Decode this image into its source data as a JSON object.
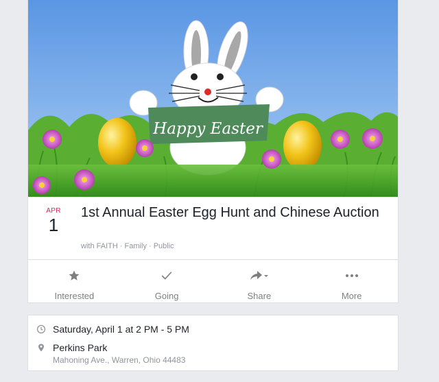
{
  "event": {
    "cover": {
      "banner_text": "Happy Easter",
      "icon": "easter-bunny-illustration"
    },
    "date": {
      "month": "APR",
      "day": "1"
    },
    "title": "1st Annual Easter Egg Hunt and Chinese Auction",
    "meta": "with FAITH · Family · Public"
  },
  "actions": [
    {
      "label": "Interested",
      "icon": "star-icon"
    },
    {
      "label": "Going",
      "icon": "check-icon"
    },
    {
      "label": "Share",
      "icon": "share-arrow-icon"
    },
    {
      "label": "More",
      "icon": "more-dots-icon"
    }
  ],
  "details": {
    "time": "Saturday, April 1 at 2 PM - 5 PM",
    "place_name": "Perkins Park",
    "place_address": "Mahoning Ave., Warren, Ohio 44483"
  },
  "colors": {
    "accent_date": "#e0245e",
    "icon_gray": "#7f7f7f",
    "background": "#e9ebee"
  }
}
